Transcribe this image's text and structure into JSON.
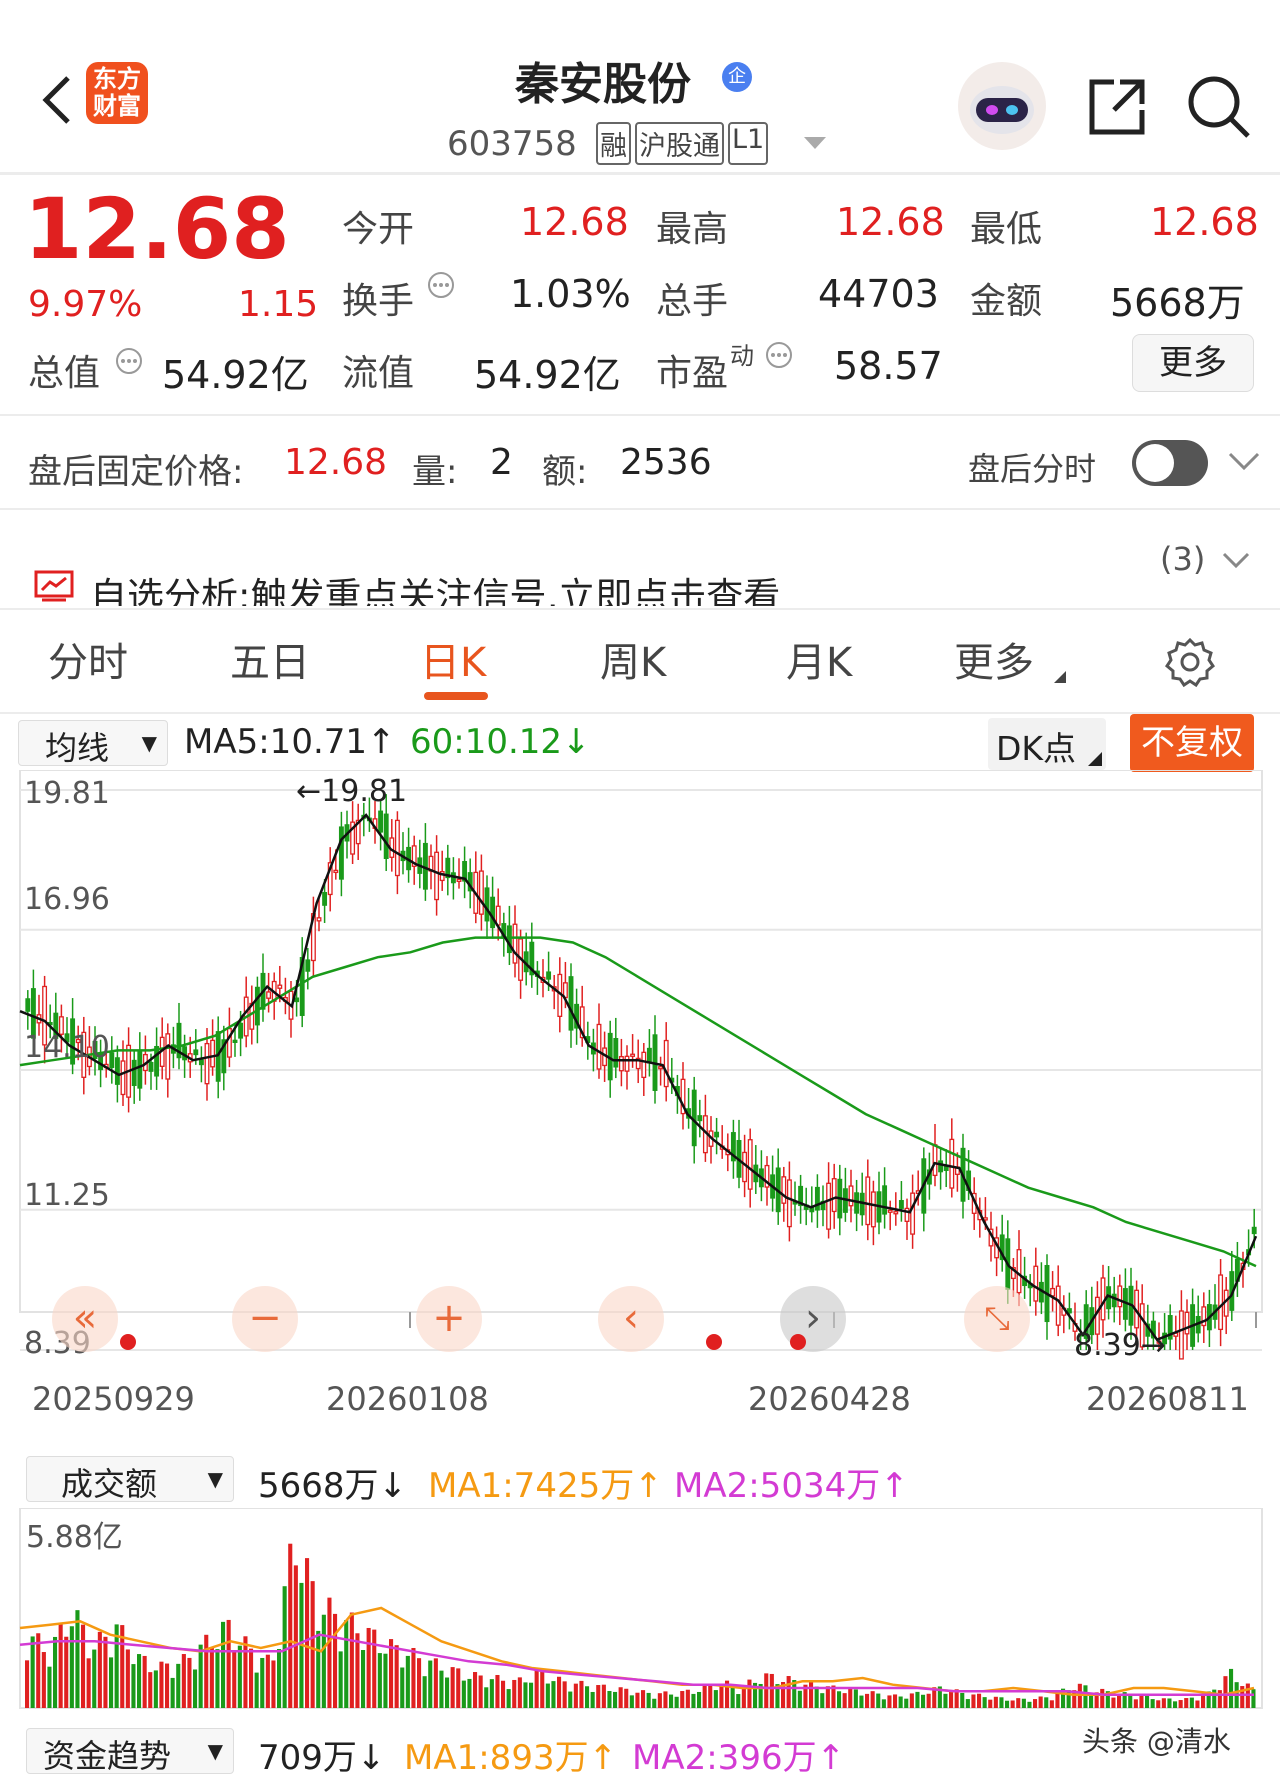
{
  "header": {
    "app_logo_text": "东方财富",
    "stock_name": "秦安股份",
    "badge_ent": "企",
    "stock_code": "603758",
    "tags": [
      "融",
      "沪股通",
      "L1"
    ]
  },
  "quote": {
    "price": "12.68",
    "change_pct": "9.97%",
    "change": "1.15",
    "rows": [
      [
        {
          "label": "今开",
          "value": "12.68",
          "red": true
        },
        {
          "label": "最高",
          "value": "12.68",
          "red": true
        },
        {
          "label": "最低",
          "value": "12.68",
          "red": true
        }
      ],
      [
        {
          "label": "换手",
          "value": "1.03%",
          "red": false,
          "info": true
        },
        {
          "label": "总手",
          "value": "44703",
          "red": false
        },
        {
          "label": "金额",
          "value": "5668万",
          "red": false
        }
      ],
      [
        {
          "label": "流值",
          "value": "54.92亿",
          "red": false
        },
        {
          "label": "市盈",
          "sup": "动",
          "value": "58.57",
          "red": false,
          "info": true
        }
      ]
    ],
    "total_value_label": "总值",
    "total_value": "54.92亿",
    "more_label": "更多"
  },
  "after_hours": {
    "label": "盘后固定价格:",
    "price": "12.68",
    "vol_label": "量:",
    "vol": "2",
    "amt_label": "额:",
    "amt": "2536",
    "toggle_label": "盘后分时"
  },
  "signal": {
    "text": "自选分析:触发重点关注信号,立即点击查看",
    "count": "(3)"
  },
  "tabs": [
    "分时",
    "五日",
    "日K",
    "周K",
    "月K",
    "更多"
  ],
  "active_tab": 2,
  "ma_bar": {
    "dropdown": "均线",
    "ma5": "MA5:10.71↑",
    "ma60": "60:10.12↓",
    "dk": "DK点",
    "fq": "不复权"
  },
  "colors": {
    "up": "#e02020",
    "down": "#1a9a1a",
    "ma5": "#111111",
    "ma60": "#1a9a1a",
    "accent": "#e8551e"
  },
  "chart_data": [
    {
      "type": "candlestick",
      "y_ticks": [
        "19.81",
        "16.96",
        "14.10",
        "11.25",
        "8.39"
      ],
      "ylim": [
        8.39,
        19.81
      ],
      "x_ticks": [
        "20250929",
        "20260108",
        "20260428",
        "20260811"
      ],
      "annotations": {
        "high": "19.81",
        "low": "8.39"
      },
      "series": [
        {
          "name": "MA5",
          "values": [
            15.3,
            15.1,
            14.6,
            14.3,
            14.0,
            14.2,
            14.6,
            14.3,
            14.4,
            15.2,
            15.8,
            15.4,
            17.5,
            18.8,
            19.3,
            18.6,
            18.3,
            18.1,
            18.0,
            17.3,
            16.5,
            16.0,
            15.6,
            14.6,
            14.3,
            14.3,
            14.2,
            13.2,
            12.7,
            12.3,
            11.9,
            11.5,
            11.3,
            11.5,
            11.4,
            11.3,
            11.2,
            12.2,
            12.1,
            11.0,
            10.1,
            9.7,
            9.4,
            8.7,
            9.5,
            9.3,
            8.6,
            8.8,
            9.0,
            9.5,
            10.71
          ]
        },
        {
          "name": "60",
          "values": [
            14.2,
            14.3,
            14.4,
            14.5,
            14.5,
            14.6,
            14.8,
            15.2,
            15.6,
            16.0,
            16.2,
            16.4,
            16.5,
            16.7,
            16.8,
            16.8,
            16.8,
            16.7,
            16.4,
            16.0,
            15.6,
            15.2,
            14.8,
            14.4,
            14.0,
            13.6,
            13.2,
            12.9,
            12.6,
            12.3,
            12.0,
            11.7,
            11.5,
            11.3,
            11.0,
            10.8,
            10.6,
            10.4,
            10.1
          ]
        }
      ]
    },
    {
      "type": "bar",
      "title": "成交额",
      "latest": "5668万↓",
      "ma1": "MA1:7425万↑",
      "ma2": "MA2:5034万↑",
      "y_max_label": "5.88亿",
      "values": [
        2.6,
        1.9,
        3.3,
        2.1,
        2.8,
        1.7,
        1.4,
        1.6,
        2.2,
        2.8,
        2.0,
        1.5,
        5.88,
        3.6,
        3.1,
        2.7,
        2.2,
        1.9,
        1.6,
        1.3,
        1.1,
        1.0,
        0.9,
        1.2,
        0.9,
        0.8,
        0.7,
        0.6,
        0.5,
        0.5,
        0.6,
        0.9,
        0.7,
        1.1,
        1.0,
        0.8,
        0.7,
        0.6,
        0.5,
        0.4,
        0.5,
        0.7,
        0.5,
        0.4,
        0.3,
        0.3,
        0.4,
        0.8,
        0.6,
        0.5,
        0.4,
        0.3,
        0.3,
        0.5,
        1.2,
        0.6
      ],
      "series": [
        {
          "name": "MA1",
          "values": [
            2.4,
            2.5,
            2.6,
            2.2,
            2.0,
            1.8,
            1.7,
            2.0,
            1.8,
            2.0,
            1.7,
            2.8,
            3.0,
            2.5,
            2.0,
            1.7,
            1.4,
            1.2,
            1.1,
            1.0,
            0.9,
            0.8,
            0.7,
            0.7,
            0.6,
            0.6,
            0.8,
            0.8,
            0.9,
            0.7,
            0.6,
            0.5,
            0.5,
            0.6,
            0.5,
            0.4,
            0.4,
            0.6,
            0.6,
            0.5,
            0.4,
            0.6
          ]
        },
        {
          "name": "MA2",
          "values": [
            1.9,
            2.0,
            2.0,
            1.9,
            1.8,
            1.7,
            1.7,
            1.7,
            2.2,
            2.0,
            1.8,
            1.6,
            1.4,
            1.3,
            1.1,
            1.0,
            0.9,
            0.8,
            0.7,
            0.7,
            0.6,
            0.6,
            0.6,
            0.6,
            0.6,
            0.5,
            0.5,
            0.5,
            0.5,
            0.4,
            0.4,
            0.4,
            0.4,
            0.4
          ]
        }
      ]
    }
  ],
  "fund_flow": {
    "dropdown": "资金趋势",
    "latest": "709万↓",
    "ma1": "MA1:893万↑",
    "ma2": "MA2:396万↑"
  },
  "watermark": "头条 @清水"
}
